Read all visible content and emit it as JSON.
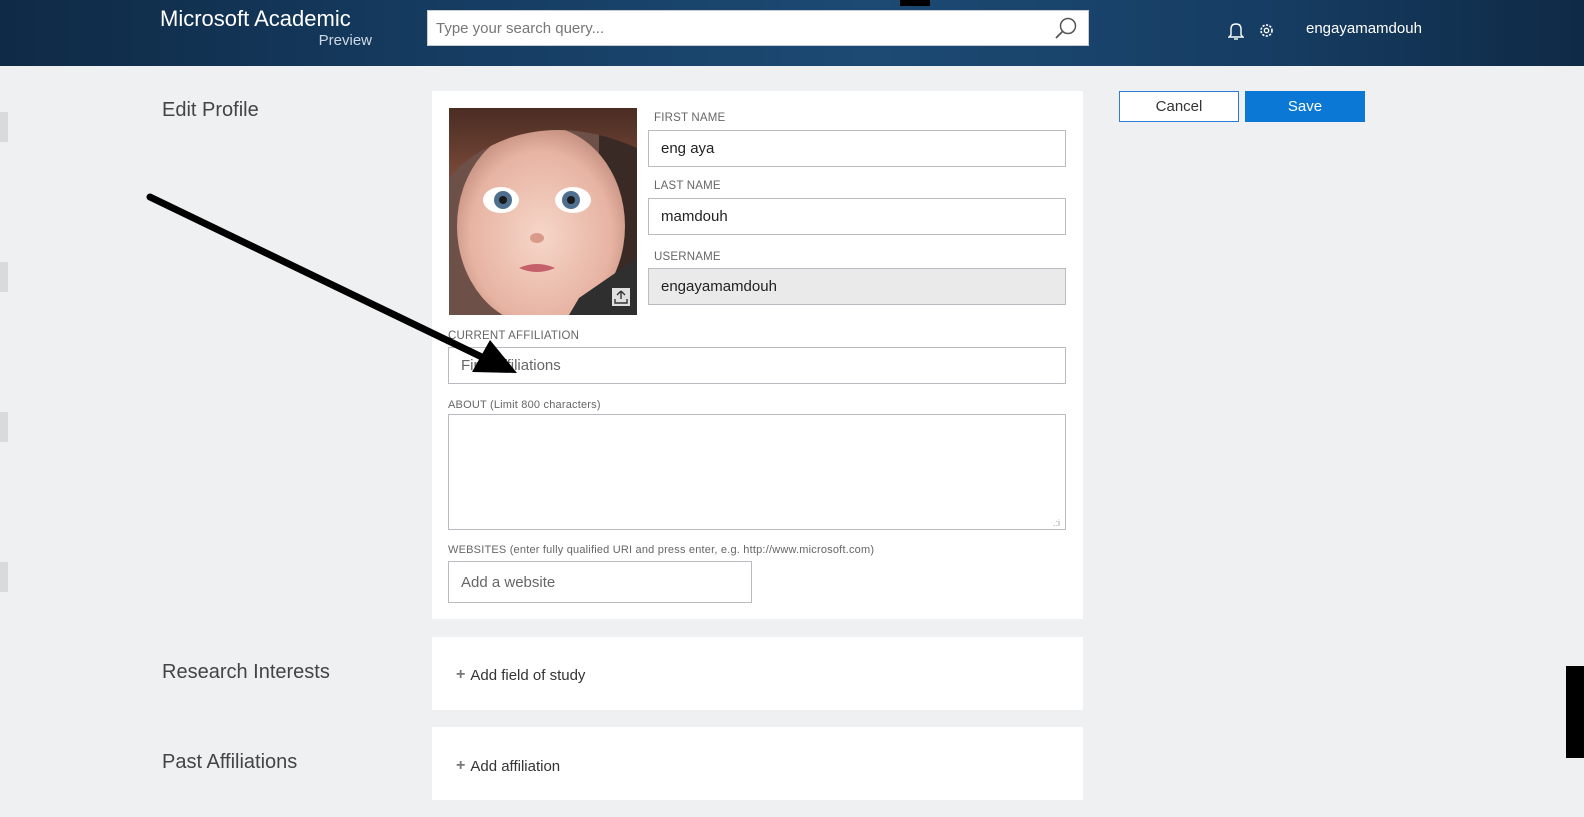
{
  "header": {
    "logo_main": "Microsoft Academic",
    "logo_sub": "Preview",
    "search_placeholder": "Type your search query...",
    "username": "engayamamdouh"
  },
  "profile": {
    "title": "Edit Profile",
    "first_name_label": "FIRST NAME",
    "first_name_value": "eng aya",
    "last_name_label": "LAST NAME",
    "last_name_value": "mamdouh",
    "username_label": "USERNAME",
    "username_value": "engayamamdouh",
    "affiliation_label": "CURRENT AFFILIATION",
    "affiliation_placeholder": "Find affiliations",
    "about_label": "ABOUT (Limit 800 characters)",
    "websites_label": "WEBSITES (enter fully qualified URI and press enter, e.g. http://www.microsoft.com)",
    "website_placeholder": "Add a website"
  },
  "actions": {
    "cancel": "Cancel",
    "save": "Save"
  },
  "research": {
    "title": "Research Interests",
    "add_label": "Add field of study"
  },
  "past": {
    "title": "Past Affiliations",
    "add_label": "Add affiliation"
  },
  "icons": {
    "search": "search-icon",
    "bell": "bell-icon",
    "gear": "gear-icon",
    "upload": "upload-icon",
    "plus": "plus-icon"
  },
  "colors": {
    "topbar": "#163d63",
    "accent": "#0a78d4",
    "page_bg": "#eef0f2"
  }
}
